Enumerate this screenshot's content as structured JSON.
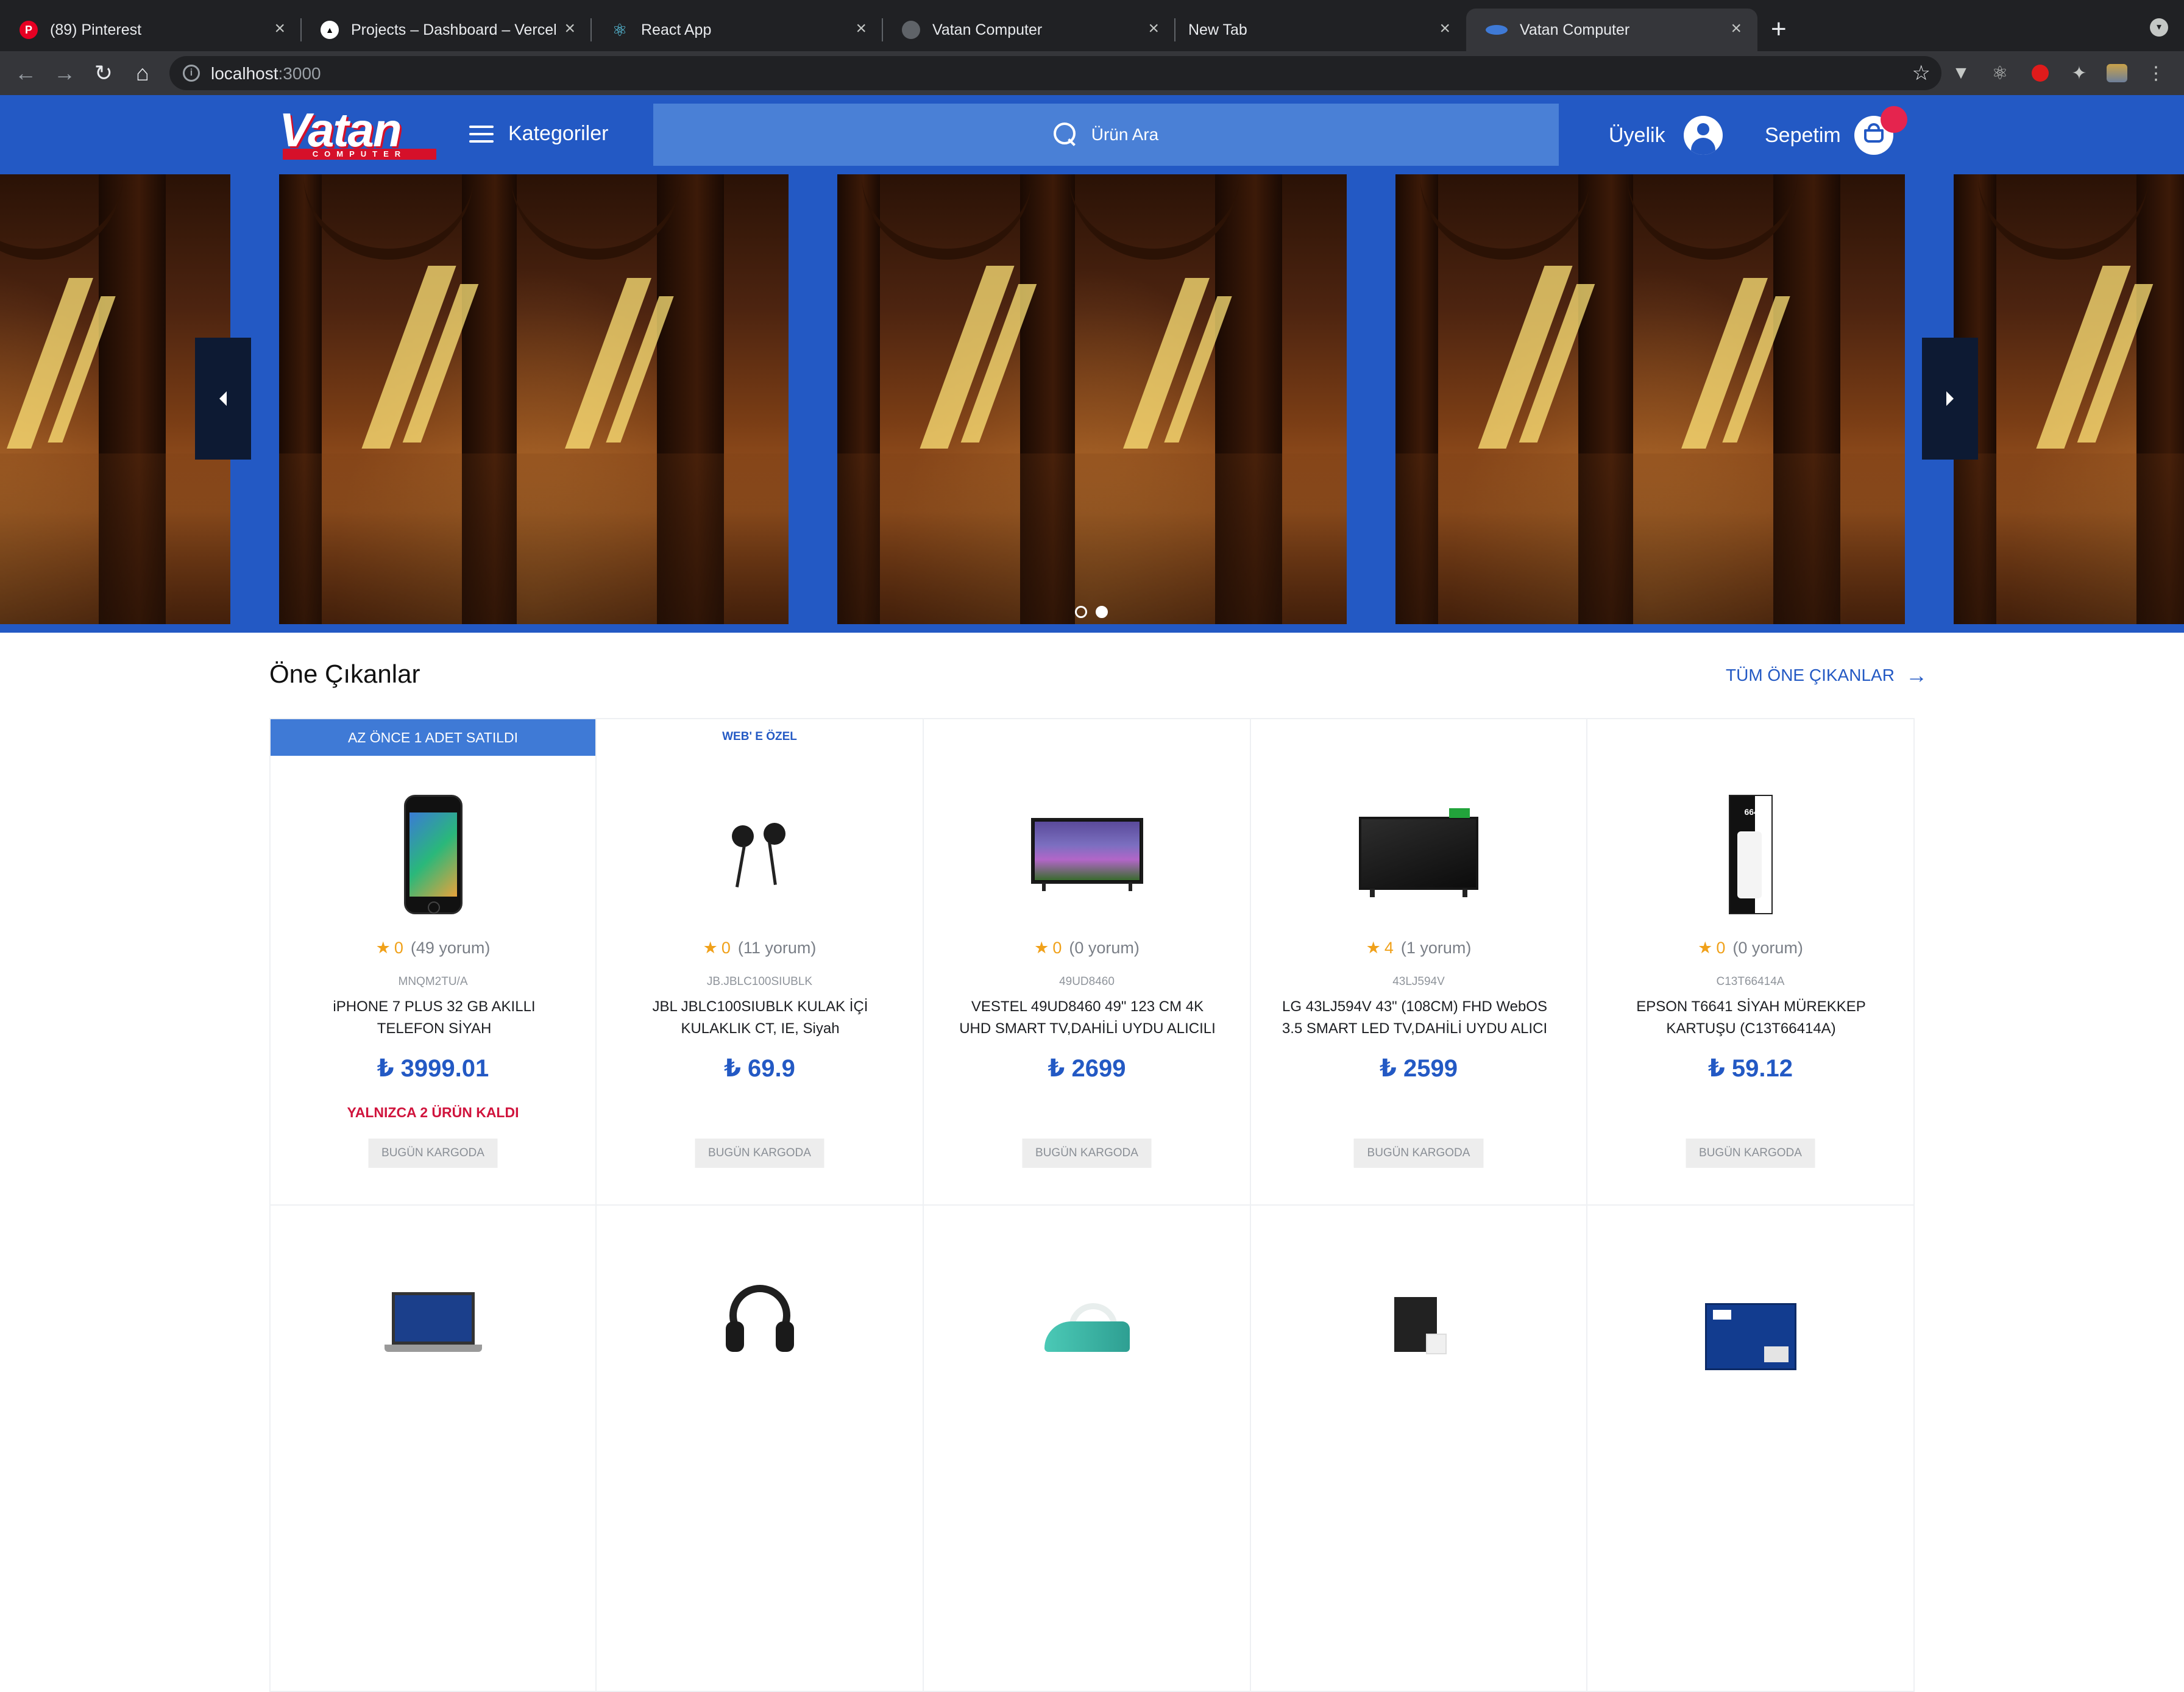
{
  "browser": {
    "tabs": [
      {
        "title": "(89) Pinterest",
        "favicon": "pinterest-icon",
        "active": false
      },
      {
        "title": "Projects – Dashboard – Vercel",
        "favicon": "vercel-icon",
        "active": false
      },
      {
        "title": "React App",
        "favicon": "react-icon",
        "active": false
      },
      {
        "title": "Vatan Computer",
        "favicon": "globe-icon",
        "active": false
      },
      {
        "title": "New Tab",
        "favicon": "",
        "active": false
      },
      {
        "title": "Vatan Computer",
        "favicon": "vatan-icon",
        "active": true
      }
    ],
    "url_host": "localhost",
    "url_port": ":3000"
  },
  "header": {
    "logo_text": "Vatan",
    "logo_sub": "COMPUTER",
    "categories_label": "Kategoriler",
    "search_placeholder": "Ürün Ara",
    "account_label": "Üyelik",
    "cart_label": "Sepetim",
    "brand_color": "#2359c4"
  },
  "carousel": {
    "slide_count": 2,
    "active_index": 1
  },
  "featured": {
    "title": "Öne Çıkanlar",
    "see_all": "TÜM ÖNE ÇIKANLAR",
    "products": [
      {
        "banner": "AZ ÖNCE 1 ADET SATILDI",
        "web_tag": "",
        "rating": "0",
        "reviews": "(49 yorum)",
        "code": "MNQM2TU/A",
        "name": "iPHONE 7 PLUS 32 GB AKILLI TELEFON SİYAH",
        "price": "₺ 3999.01",
        "stock_note": "YALNIZCA 2 ÜRÜN KALDI",
        "shipping": "BUGÜN KARGODA",
        "image": "smartphone"
      },
      {
        "banner": "",
        "web_tag": "WEB' E ÖZEL",
        "rating": "0",
        "reviews": "(11 yorum)",
        "code": "JB.JBLC100SIUBLK",
        "name": "JBL JBLC100SIUBLK KULAK İÇİ KULAKLIK CT, IE, Siyah",
        "price": "₺ 69.9",
        "stock_note": "",
        "shipping": "BUGÜN KARGODA",
        "image": "earphones"
      },
      {
        "banner": "",
        "web_tag": "",
        "rating": "0",
        "reviews": "(0 yorum)",
        "code": "49UD8460",
        "name": "VESTEL 49UD8460 49\" 123 CM 4K UHD SMART TV,DAHİLİ UYDU ALICILI",
        "price": "₺ 2699",
        "stock_note": "",
        "shipping": "BUGÜN KARGODA",
        "image": "television"
      },
      {
        "banner": "",
        "web_tag": "",
        "rating": "4",
        "reviews": "(1 yorum)",
        "code": "43LJ594V",
        "name": "LG 43LJ594V 43\" (108CM) FHD WebOS 3.5 SMART LED TV,DAHİLİ UYDU ALICI",
        "price": "₺ 2599",
        "stock_note": "",
        "shipping": "BUGÜN KARGODA",
        "image": "television-dark"
      },
      {
        "banner": "",
        "web_tag": "",
        "rating": "0",
        "reviews": "(0 yorum)",
        "code": "C13T66414A",
        "name": "EPSON T6641 SİYAH MÜREKKEP KARTUŞU (C13T66414A)",
        "price": "₺ 59.12",
        "stock_note": "",
        "shipping": "BUGÜN KARGODA",
        "image": "ink-bottle",
        "image_label": "664"
      }
    ],
    "second_row_images": [
      "laptop",
      "headphones",
      "steam-iron",
      "smart-hub-box",
      "ssd"
    ]
  }
}
